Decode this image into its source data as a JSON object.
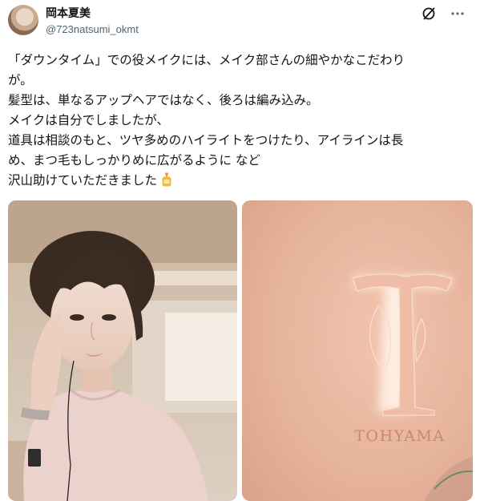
{
  "author": {
    "display_name": "岡本夏美",
    "handle": "@723natsumi_okmt"
  },
  "header_icons": [
    "grok-icon",
    "more-options-icon"
  ],
  "tweet": {
    "lines": [
      "「ダウンタイム」での役メイクには、メイク部さんの細やかなこだわり",
      "が。",
      "髪型は、単なるアップヘアではなく、後ろは編み込み。",
      "メイクは自分でしましたが、",
      "道具は相談のもと、ツヤ多めのハイライトをつけたり、アイラインは長",
      "め、まつ毛もしっかりめに広がるように など",
      "沢山助けていただきました"
    ],
    "emoji_icon": "lotion-bottle-icon"
  },
  "media": {
    "left_photo": "selfie-photo",
    "right_photo": {
      "sign_text": "TOHYAMA"
    }
  },
  "colors": {
    "text": "#0f1419",
    "secondary": "#536471",
    "wall": "#e7b49d",
    "logo": "#f6c7b2"
  }
}
